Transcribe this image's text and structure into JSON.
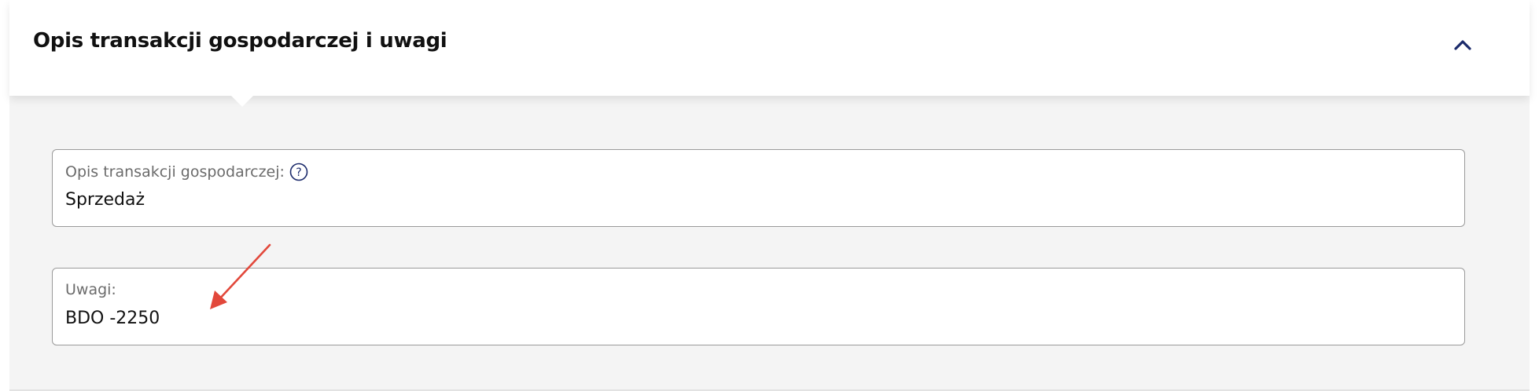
{
  "section": {
    "title": "Opis transakcji gospodarczej i uwagi",
    "collapse_icon": "chevron-up-icon"
  },
  "fields": {
    "description": {
      "label": "Opis transakcji gospodarczej:",
      "value": "Sprzedaż",
      "help_icon": "question-circle-icon"
    },
    "notes": {
      "label": "Uwagi:",
      "value": "BDO -2250"
    }
  },
  "annotation": {
    "arrow_icon": "annotation-arrow-icon",
    "color": "#e2483b"
  },
  "colors": {
    "panel_background": "#f4f4f4",
    "field_border": "#9a9a9a",
    "accent": "#1b2a6b"
  }
}
